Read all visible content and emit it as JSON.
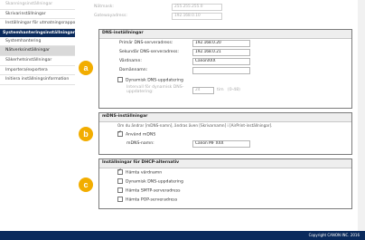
{
  "sidebar": {
    "items": [
      {
        "label": "Skanningsinställningar",
        "state": "faded"
      },
      {
        "label": "Skrivarinställningar",
        "state": "normal"
      },
      {
        "label": "Inställningar för utmatningsrapport",
        "state": "normal"
      }
    ],
    "group_title": "Systemhanteringsinställningar",
    "group_items": [
      {
        "label": "Systemhantering",
        "state": "normal"
      },
      {
        "label": "Nätverksinställningar",
        "state": "active"
      },
      {
        "label": "Säkerhetsinställningar",
        "state": "normal"
      },
      {
        "label": "Importera/exportera",
        "state": "normal"
      },
      {
        "label": "Initiera inställningsinformation",
        "state": "normal"
      }
    ]
  },
  "top_rows": [
    {
      "label": "Nätmask:",
      "value": "255.255.255.0"
    },
    {
      "label": "Gatewayadress:",
      "value": "192.168.0.10"
    }
  ],
  "dns": {
    "title": "DNS-inställningar",
    "primary_label": "Primär DNS-serveradress:",
    "primary_value": "192.168.0.20",
    "secondary_label": "Sekundär DNS-serveradress:",
    "secondary_value": "192.168.0.21",
    "host_label": "Värdnamn:",
    "host_value": "CanonXXX",
    "domain_label": "Domännamn:",
    "domain_value": "",
    "dynamic_label": "Dynamisk DNS-uppdatering",
    "interval_label": "Intervall för dynamisk DNS-uppdatering:",
    "interval_value": "24",
    "interval_unit": "tim   (0-48)"
  },
  "mdns": {
    "title": "mDNS-inställningar",
    "note": "Om du ändrar [mDNS-namn], ändras även [Skrivarnamn] i [AirPrint-inställningar].",
    "use_label": "Använd mDNS",
    "name_label": "mDNS-namn:",
    "name_value": "Canon MF XXX"
  },
  "dhcp": {
    "title": "Inställningar för DHCP-alternativ",
    "options": [
      {
        "label": "Hämta värdnamn",
        "checked": true
      },
      {
        "label": "Dynamisk DNS-uppdatering",
        "checked": false
      },
      {
        "label": "Hämta SMTP-serveradress",
        "checked": false
      },
      {
        "label": "Hämta POP-serveradress",
        "checked": false
      }
    ]
  },
  "callouts": {
    "a": "a",
    "b": "b",
    "c": "c"
  },
  "footer": {
    "copyright": "Copyright CANON INC. 2016"
  },
  "colors": {
    "badge": "#f2ad00",
    "navy": "#0a2a5c"
  }
}
